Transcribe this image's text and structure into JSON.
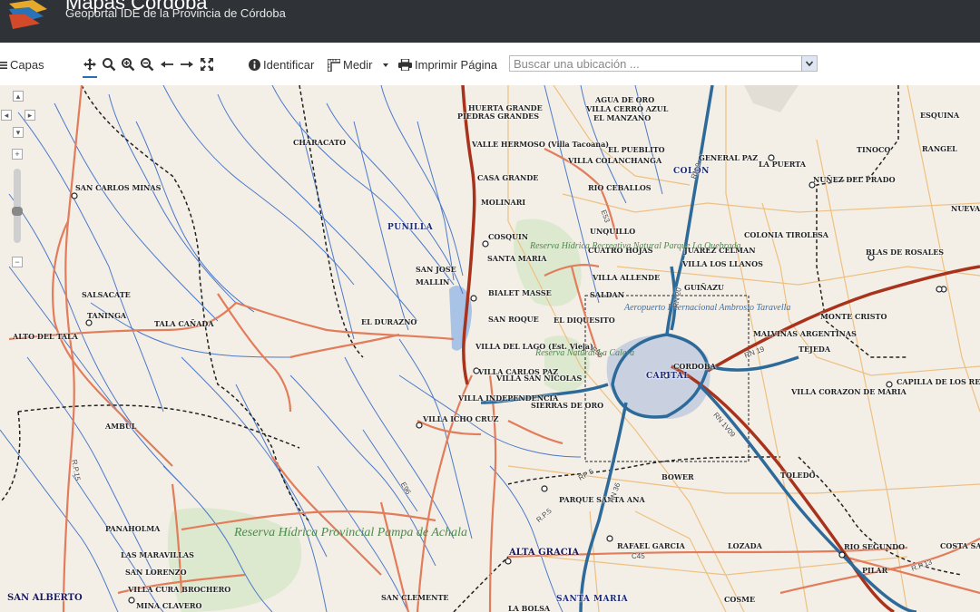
{
  "header": {
    "title": "Mapas Córdoba",
    "subtitle": "Geoportal IDE de la Provincia de Córdoba"
  },
  "toolbar": {
    "layers_label": "Capas",
    "identify_label": "Identificar",
    "measure_label": "Medir",
    "print_label": "Imprimir Página",
    "search_placeholder": "Buscar una ubicación ...",
    "icons": [
      "menu-icon",
      "pan-icon",
      "zoom-box-icon",
      "zoom-in-icon",
      "zoom-out-icon",
      "back-arrow-icon",
      "forward-arrow-icon",
      "full-extent-icon",
      "info-icon",
      "ruler-icon",
      "caret-down-icon",
      "printer-icon"
    ]
  },
  "zoom_controls": {
    "plus": "+",
    "minus": "−"
  },
  "map": {
    "departments": [
      "PUNILLA",
      "COLON",
      "CAPITAL",
      "SANTA MARIA"
    ],
    "places": [
      "HUERTA GRANDE",
      "PIEDRAS GRANDES",
      "VALLE HERMOSO (Villa Tacoana)",
      "CASA GRANDE",
      "MOLINARI",
      "COSQUIN",
      "SANTA MARIA",
      "BIALET MASSE",
      "SAN ROQUE",
      "VILLA DEL LAGO (Est. Vieja)",
      "VILLA CARLOS PAZ",
      "VILLA SAN NICOLAS",
      "VILLA INDEPENDENCIA",
      "SIERRAS DE ORO",
      "VILLA ICHO CRUZ",
      "AGUA DE ORO",
      "VILLA CERRO AZUL",
      "EL MANZANO",
      "EL PUEBLITO",
      "VILLA COLANCHANGA",
      "RIO CEBALLOS",
      "UNQUILLO",
      "CUATRO HOJAS",
      "VILLA ALLENDE",
      "SALDAN",
      "EL DIQUESITO",
      "JUAREZ CELMAN",
      "VILLA LOS LLANOS",
      "GUIÑAZU",
      "GENERAL PAZ",
      "LA PUERTA",
      "NUÑEZ DEL PRADO",
      "COLONIA TIROLESA",
      "TINOCO",
      "RANGEL",
      "ESQUINA",
      "NUEVA",
      "BLAS DE ROSALES",
      "MONTE CRISTO",
      "MALVINAS ARGENTINAS",
      "TEJEDA",
      "VILLA CORAZON DE MARIA",
      "CAPILLA DE LOS REMEDIOS",
      "CORDOBA",
      "CHARACATO",
      "SAN CARLOS MINAS",
      "SALSACATE",
      "TANINGA",
      "TALA CAÑADA",
      "ALTO DEL TALA",
      "SAN JOSE",
      "MALLIN",
      "EL DURAZNO",
      "AMBUL",
      "PANAHOLMA",
      "LAS MARAVILLAS",
      "SAN LORENZO",
      "VILLA CURA BROCHERO",
      "SAN ALBERTO",
      "MINA CLAVERO",
      "SAN CLEMENTE",
      "LA BOLSA",
      "ALTA GRACIA",
      "PARQUE SANTA ANA",
      "BOWER",
      "RAFAEL GARCIA",
      "LOZADA",
      "TOLEDO",
      "RIO SEGUNDO",
      "PILAR",
      "COSTA SACATE",
      "COSME"
    ],
    "roads": [
      "R.P.15",
      "RN 9",
      "RN 19",
      "RN 36",
      "RN 20",
      "RP 5",
      "C45",
      "E53",
      "E55",
      "E96",
      "RN 1V09",
      "R.P.13",
      "RN 38",
      "R.P.5"
    ],
    "parks": [
      "Reserva Hídrica Provincial Pampa de Achala",
      "Reserva Hídrica Recreativa Natural Parque La Quebrada",
      "Reserva Natural La Calera",
      "Aeropuerto Internacional Ambrosio Taravella"
    ],
    "colors": {
      "background": "#f3efe6",
      "river": "#4c79c9",
      "major_road": "#b1391f",
      "road": "#e27c5b",
      "highway": "#2d6a9a",
      "boundary": "#333333",
      "park": "#d8ead0",
      "urban": "#c9d1e0",
      "secondary": "#f0c27a"
    }
  }
}
